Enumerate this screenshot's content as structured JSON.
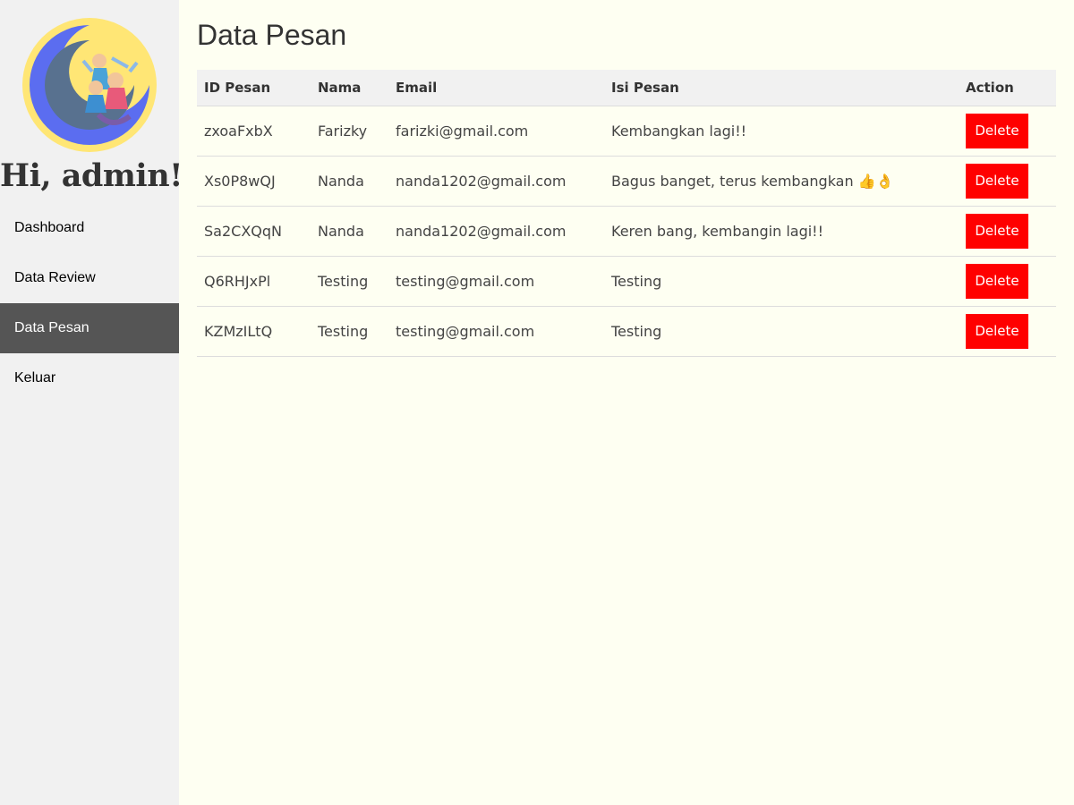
{
  "sidebar": {
    "greeting": "Hi, admin!",
    "logo_icon": "family-playing-logo",
    "items": [
      {
        "label": "Dashboard",
        "active": false
      },
      {
        "label": "Data Review",
        "active": false
      },
      {
        "label": "Data Pesan",
        "active": true
      },
      {
        "label": "Keluar",
        "active": false
      }
    ]
  },
  "main": {
    "title": "Data Pesan",
    "table": {
      "headers": [
        "ID Pesan",
        "Nama",
        "Email",
        "Isi Pesan",
        "Action"
      ],
      "rows": [
        {
          "id": "zxoaFxbX",
          "nama": "Farizky",
          "email": "farizki@gmail.com",
          "isi": "Kembangkan lagi!!",
          "action": "Delete"
        },
        {
          "id": "Xs0P8wQJ",
          "nama": "Nanda",
          "email": "nanda1202@gmail.com",
          "isi": "Bagus banget, terus kembangkan 👍👌",
          "action": "Delete"
        },
        {
          "id": "Sa2CXQqN",
          "nama": "Nanda",
          "email": "nanda1202@gmail.com",
          "isi": "Keren bang, kembangin lagi!!",
          "action": "Delete"
        },
        {
          "id": "Q6RHJxPl",
          "nama": "Testing",
          "email": "testing@gmail.com",
          "isi": "Testing",
          "action": "Delete"
        },
        {
          "id": "KZMzILtQ",
          "nama": "Testing",
          "email": "testing@gmail.com",
          "isi": "Testing",
          "action": "Delete"
        }
      ]
    }
  },
  "colors": {
    "page_background": "#fefff2",
    "sidebar_background": "#f1f1f1",
    "active_nav_background": "#555555",
    "delete_button": "#ff0000",
    "logo_yellow": "#ffe675",
    "logo_blue": "#5b6df0"
  }
}
